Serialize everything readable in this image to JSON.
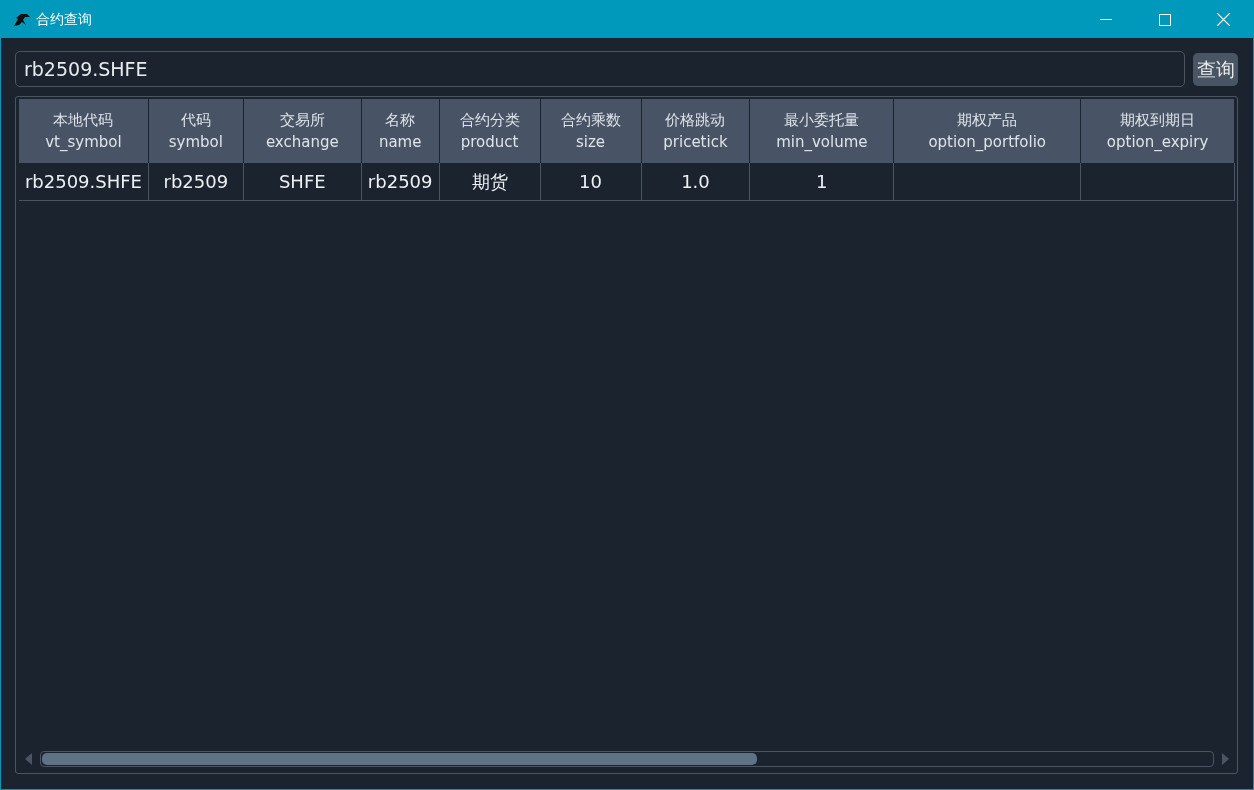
{
  "window": {
    "title": "合约查询"
  },
  "search": {
    "value": "rb2509.SHFE",
    "button": "查询"
  },
  "table": {
    "columns": [
      {
        "label": "本地代码",
        "key": "vt_symbol"
      },
      {
        "label": "代码",
        "key": "symbol"
      },
      {
        "label": "交易所",
        "key": "exchange"
      },
      {
        "label": "名称",
        "key": "name"
      },
      {
        "label": "合约分类",
        "key": "product"
      },
      {
        "label": "合约乘数",
        "key": "size"
      },
      {
        "label": "价格跳动",
        "key": "pricetick"
      },
      {
        "label": "最小委托量",
        "key": "min_volume"
      },
      {
        "label": "期权产品",
        "key": "option_portfolio"
      },
      {
        "label": "期权到期日",
        "key": "option_expiry"
      }
    ],
    "rows": [
      {
        "cells": [
          "rb2509.SHFE",
          "rb2509",
          "SHFE",
          "rb2509",
          "期货",
          "10",
          "1.0",
          "1"
        ]
      }
    ]
  }
}
